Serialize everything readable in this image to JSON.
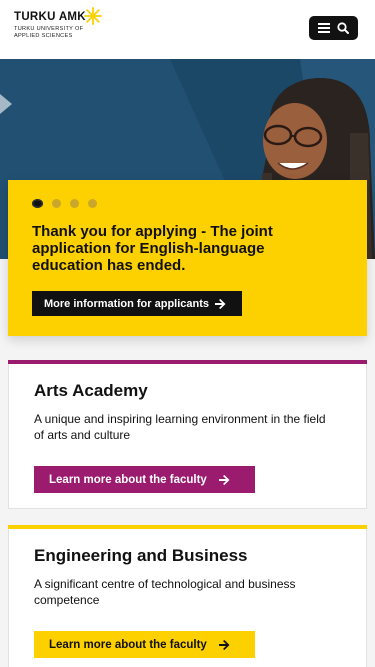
{
  "header": {
    "logo_title": "TURKU AMK",
    "logo_subtitle": "TURKU UNIVERSITY OF APPLIED SCIENCES",
    "menu_icon": "hamburger-icon",
    "search_icon": "search-icon"
  },
  "hero": {
    "slides_count": 4,
    "active_slide": 1,
    "title": "Thank you for applying - The joint application for English-language education has ended.",
    "button_label": "More information for applicants",
    "button_icon": "arrow-right-icon"
  },
  "faculties": [
    {
      "title": "Arts Academy",
      "description": "A unique and inspiring learning environment in the field of arts and culture",
      "button_label": "Learn more about the faculty",
      "accent_color": "#9b1b6e",
      "button_text_color": "#ffffff"
    },
    {
      "title": "Engineering and Business",
      "description": "A significant centre of technological and business competence",
      "button_label": "Learn more about the faculty",
      "accent_color": "#fdd000",
      "button_text_color": "#111111"
    }
  ],
  "colors": {
    "brand_yellow": "#fdd000",
    "arts_purple": "#9b1b6e",
    "hero_blue": "#1d4a6b",
    "dark": "#111111"
  }
}
